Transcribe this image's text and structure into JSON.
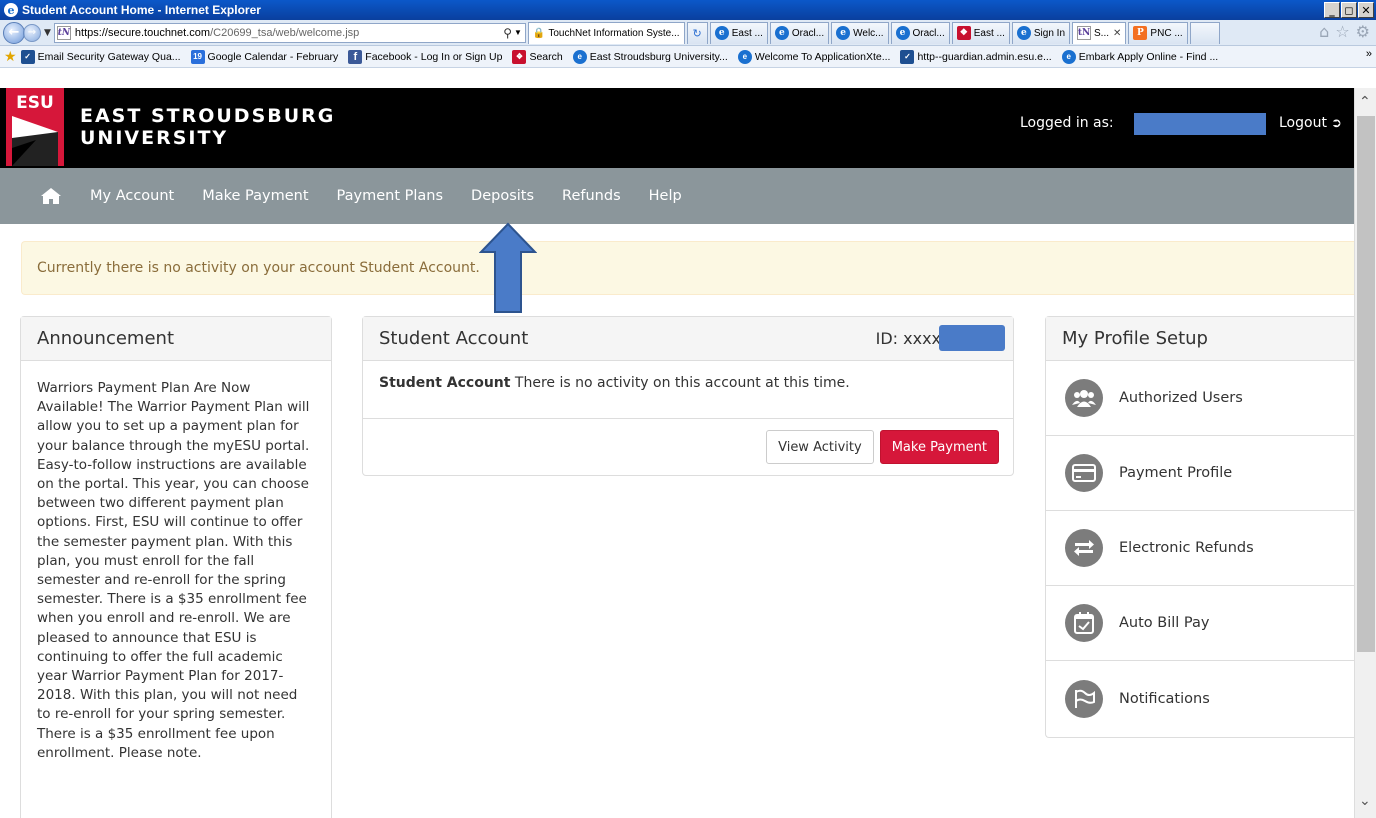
{
  "browser": {
    "window_title": "Student Account Home - Internet Explorer",
    "address": {
      "scheme": "https://",
      "host": "secure.touchnet.com",
      "path": "/C20699_tsa/web/welcome.jsp"
    },
    "site_tab_label": "TouchNet Information Syste...",
    "tabs": [
      "East ...",
      "Oracl...",
      "Welc...",
      "Oracl...",
      "East ...",
      "Sign In",
      "S...",
      "PNC ..."
    ],
    "favorites": [
      "Email Security Gateway Qua...",
      "Google Calendar - February",
      "Facebook - Log In or Sign Up",
      "Search",
      "East Stroudsburg University...",
      "Welcome To ApplicationXte...",
      "http--guardian.admin.esu.e...",
      "Embark Apply Online - Find ..."
    ],
    "calendar_day": "19"
  },
  "header": {
    "logo_mark": "ESU",
    "logo_line1": "EAST STROUDSBURG",
    "logo_line2": "UNIVERSITY",
    "logged_in_label": "Logged in as:",
    "logout_label": "Logout"
  },
  "nav": {
    "items": [
      "My Account",
      "Make Payment",
      "Payment Plans",
      "Deposits",
      "Refunds",
      "Help"
    ]
  },
  "alert": {
    "text": "Currently there is no activity on your account Student Account."
  },
  "announcement": {
    "title": "Announcement",
    "body": "Warriors Payment Plan Are Now Available! The Warrior Payment Plan will allow you to set up a payment plan for your balance through the myESU portal. Easy-to-follow instructions are available on the portal. This year, you can choose between two different payment plan options. First, ESU will continue to offer the semester payment plan. With this plan, you must enroll for the fall semester and re-enroll for the spring semester. There is a $35 enrollment fee when you enroll and re-enroll. We are pleased to announce that ESU is continuing to offer the full academic year Warrior Payment Plan for 2017-2018. With this plan, you will not need to re-enroll for your spring semester. There is a $35 enrollment fee upon enrollment. Please note."
  },
  "student_account": {
    "title": "Student Account",
    "id_label": "ID: xxxx",
    "body_bold": "Student Account",
    "body_text": " There is no activity on this account at this time.",
    "view_activity": "View Activity",
    "make_payment": "Make Payment"
  },
  "profile": {
    "title": "My Profile Setup",
    "items": [
      {
        "label": "Authorized Users",
        "icon": "users-icon"
      },
      {
        "label": "Payment Profile",
        "icon": "credit-card-icon"
      },
      {
        "label": "Electronic Refunds",
        "icon": "refund-arrows-icon"
      },
      {
        "label": "Auto Bill Pay",
        "icon": "calendar-check-icon"
      },
      {
        "label": "Notifications",
        "icon": "flag-icon"
      }
    ]
  },
  "colors": {
    "header_bg": "#000000",
    "nav_bg": "#8b969b",
    "primary_button": "#d6173a",
    "alert_bg": "#fcf8e3",
    "alert_text": "#8a6d3b",
    "annotation_arrow": "#4a7bc8",
    "redaction": "#4a7bc8"
  }
}
